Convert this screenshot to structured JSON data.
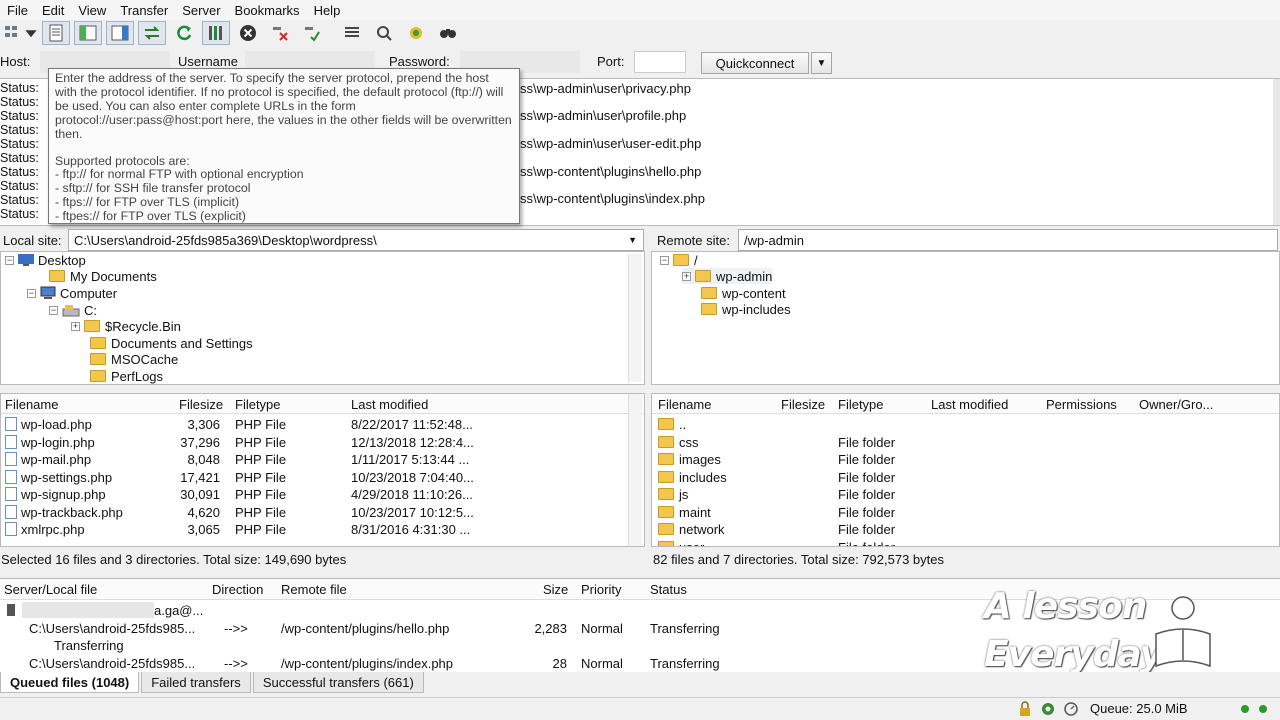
{
  "menu": [
    "File",
    "Edit",
    "View",
    "Transfer",
    "Server",
    "Bookmarks",
    "Help"
  ],
  "toolbar_icons": [
    "site-manager-icon",
    "dropdown-arrow-icon",
    "toggle-log-icon",
    "toggle-local-tree-icon",
    "toggle-remote-tree-icon",
    "toggle-queue-icon",
    "refresh-icon",
    "process-queue-icon",
    "cancel-icon",
    "disconnect-icon",
    "reconnect-icon",
    "directory-listing-filter-icon",
    "compare-icon",
    "sync-browse-icon",
    "search-icon"
  ],
  "quickconnect": {
    "host_label": "Host:",
    "username_label": "Username",
    "password_label": "Password:",
    "port_label": "Port:",
    "port_value": "",
    "button": "Quickconnect"
  },
  "log": {
    "status_label": "Status:",
    "rows": 10,
    "messages": [
      "ss\\wp-admin\\user\\privacy.php",
      "ss\\wp-admin\\user\\profile.php",
      "ss\\wp-admin\\user\\user-edit.php",
      "ss\\wp-content\\plugins\\hello.php",
      "ss\\wp-content\\plugins\\index.php"
    ]
  },
  "tooltip": {
    "text": "Enter the address of the server. To specify the server protocol, prepend the host with the protocol identifier. If no protocol is specified, the default protocol (ftp://) will be used. You can also enter complete URLs in the form protocol://user:pass@host:port here, the values in the other fields will be overwritten then.",
    "protocols_title": "Supported protocols are:",
    "protocols": [
      "- ftp:// for normal FTP with optional encryption",
      "- sftp:// for SSH file transfer protocol",
      "- ftps:// for FTP over TLS (implicit)",
      "- ftpes:// for FTP over TLS (explicit)"
    ]
  },
  "local": {
    "site_label": "Local site:",
    "site_path": "C:\\Users\\android-25fds985a369\\Desktop\\wordpress\\",
    "tree": [
      "Desktop",
      "My Documents",
      "Computer",
      "C:",
      "$Recycle.Bin",
      "Documents and Settings",
      "MSOCache",
      "PerfLogs"
    ],
    "columns": [
      "Filename",
      "Filesize",
      "Filetype",
      "Last modified"
    ],
    "files": [
      {
        "name": "wp-load.php",
        "size": "3,306",
        "type": "PHP File",
        "modified": "8/22/2017 11:52:48..."
      },
      {
        "name": "wp-login.php",
        "size": "37,296",
        "type": "PHP File",
        "modified": "12/13/2018 12:28:4..."
      },
      {
        "name": "wp-mail.php",
        "size": "8,048",
        "type": "PHP File",
        "modified": "1/11/2017 5:13:44 ..."
      },
      {
        "name": "wp-settings.php",
        "size": "17,421",
        "type": "PHP File",
        "modified": "10/23/2018 7:04:40..."
      },
      {
        "name": "wp-signup.php",
        "size": "30,091",
        "type": "PHP File",
        "modified": "4/29/2018 11:10:26..."
      },
      {
        "name": "wp-trackback.php",
        "size": "4,620",
        "type": "PHP File",
        "modified": "10/23/2017 10:12:5..."
      },
      {
        "name": "xmlrpc.php",
        "size": "3,065",
        "type": "PHP File",
        "modified": "8/31/2016 4:31:30 ..."
      }
    ],
    "status": "Selected 16 files and 3 directories. Total size: 149,690 bytes"
  },
  "remote": {
    "site_label": "Remote site:",
    "site_path": "/wp-admin",
    "tree": [
      "/",
      "wp-admin",
      "wp-content",
      "wp-includes"
    ],
    "columns": [
      "Filename",
      "Filesize",
      "Filetype",
      "Last modified",
      "Permissions",
      "Owner/Gro..."
    ],
    "files": [
      {
        "name": "..",
        "type": ""
      },
      {
        "name": "css",
        "type": "File folder"
      },
      {
        "name": "images",
        "type": "File folder"
      },
      {
        "name": "includes",
        "type": "File folder"
      },
      {
        "name": "js",
        "type": "File folder"
      },
      {
        "name": "maint",
        "type": "File folder"
      },
      {
        "name": "network",
        "type": "File folder"
      },
      {
        "name": "user",
        "type": "File folder"
      }
    ],
    "status": "82 files and 7 directories. Total size: 792,573 bytes"
  },
  "queue": {
    "columns": [
      "Server/Local file",
      "Direction",
      "Remote file",
      "Size",
      "Priority",
      "Status"
    ],
    "server": "a.ga@...",
    "items": [
      {
        "local": "C:\\Users\\android-25fds985...",
        "direction": "-->>",
        "remote": "/wp-content/plugins/hello.php",
        "size": "2,283",
        "priority": "Normal",
        "status": "Transferring"
      },
      {
        "local": "C:\\Users\\android-25fds985...",
        "direction": "-->>",
        "remote": "/wp-content/plugins/index.php",
        "size": "28",
        "priority": "Normal",
        "status": "Transferring"
      }
    ],
    "sub_status": "Transferring",
    "tabs": [
      "Queued files (1048)",
      "Failed transfers",
      "Successful transfers (661)"
    ]
  },
  "statusbar": {
    "queue": "Queue: 25.0 MiB"
  },
  "watermark": {
    "line1": "A lesson",
    "line2": "Everyday"
  }
}
